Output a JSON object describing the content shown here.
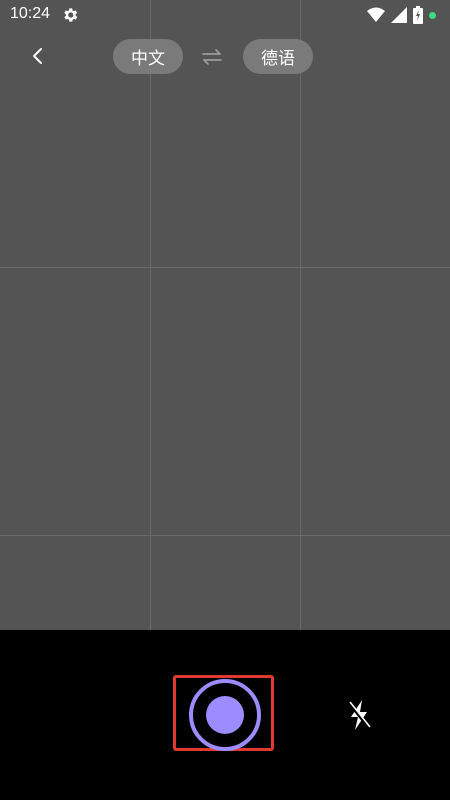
{
  "status_bar": {
    "time": "10:24",
    "icons": [
      "settings-icon",
      "wifi-icon",
      "signal-icon",
      "battery-icon",
      "notification-dot"
    ]
  },
  "toolbar": {
    "back_icon": "chevron-left-icon",
    "source_language": "中文",
    "swap_icon": "swap-icon",
    "target_language": "德语"
  },
  "camera": {
    "grid": "3x3",
    "shutter_icon": "shutter-icon",
    "flash_icon": "flash-off-icon"
  },
  "colors": {
    "viewfinder_bg": "#545454",
    "accent": "#9b8cff",
    "highlight": "#e0392f"
  }
}
